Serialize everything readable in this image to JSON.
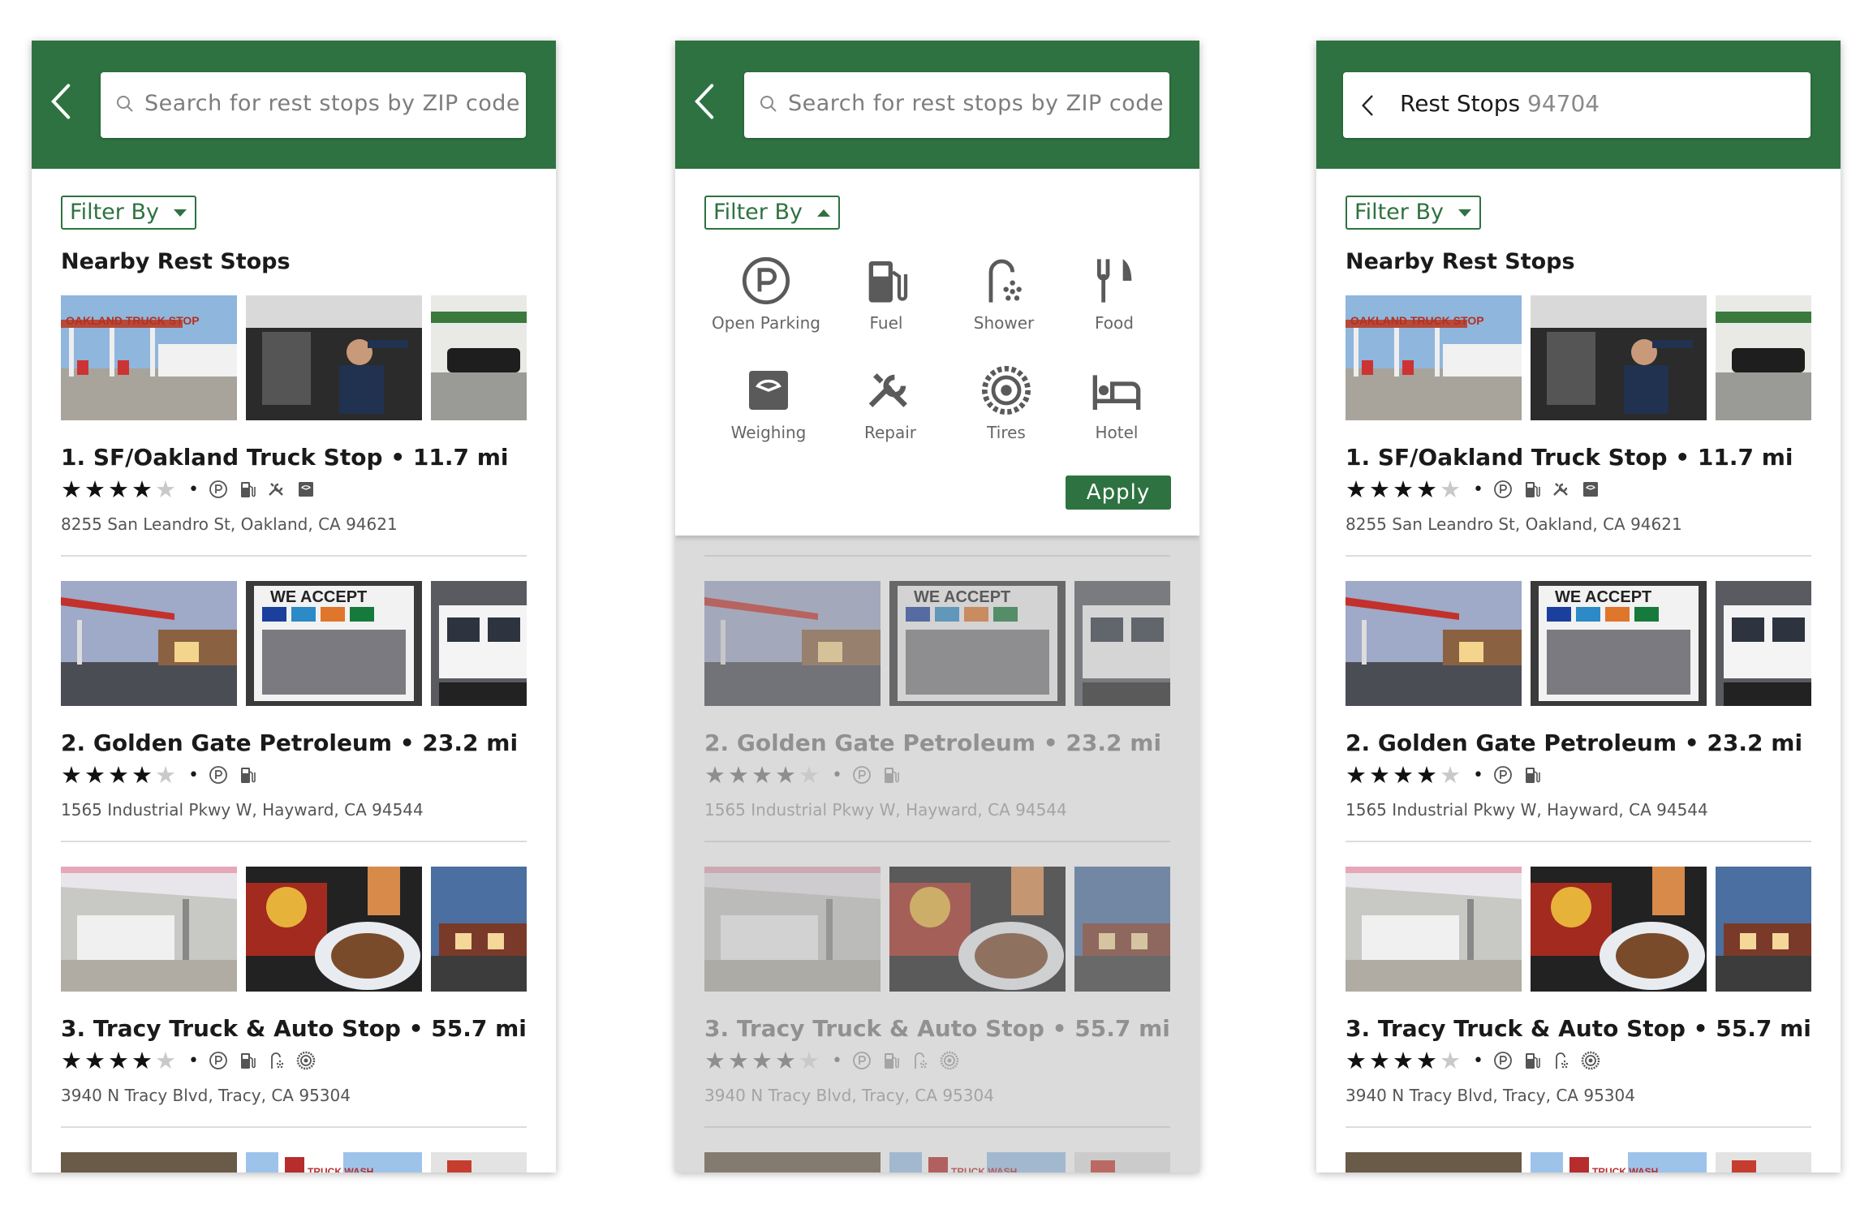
{
  "colors": {
    "brand_green": "#2e7241",
    "star_on": "#111111",
    "star_off": "#c9c9c9"
  },
  "search": {
    "placeholder": "Search for rest stops by ZIP code"
  },
  "screen3_header": {
    "label": "Rest Stops",
    "zip": "94704"
  },
  "filter": {
    "label": "Filter By",
    "apply_label": "Apply",
    "options": [
      "Open Parking",
      "Fuel",
      "Shower",
      "Food",
      "Weighing",
      "Repair",
      "Tires",
      "Hotel"
    ]
  },
  "section_title": "Nearby Rest Stops",
  "stops": [
    {
      "name": "1. SF/Oakland Truck Stop • 11.7 mi",
      "rating": 4,
      "amenities": [
        "parking-icon",
        "fuel-icon",
        "repair-icon",
        "weighing-icon"
      ],
      "address": "8255 San Leandro St, Oakland, CA 94621"
    },
    {
      "name": "2. Golden Gate Petroleum • 23.2 mi",
      "rating": 4,
      "amenities": [
        "parking-icon",
        "fuel-icon"
      ],
      "address": "1565 Industrial Pkwy W, Hayward, CA 94544"
    },
    {
      "name": "3. Tracy Truck & Auto Stop • 55.7 mi",
      "rating": 4,
      "amenities": [
        "parking-icon",
        "fuel-icon",
        "shower-icon",
        "tires-icon"
      ],
      "address": "3940 N Tracy Blvd, Tracy, CA 95304"
    }
  ],
  "photo_texts": {
    "oakland_sign": "OAKLAND TRUCK STOP",
    "we_accept": "WE ACCEPT",
    "truck_wash": "TRUCK WASH"
  }
}
